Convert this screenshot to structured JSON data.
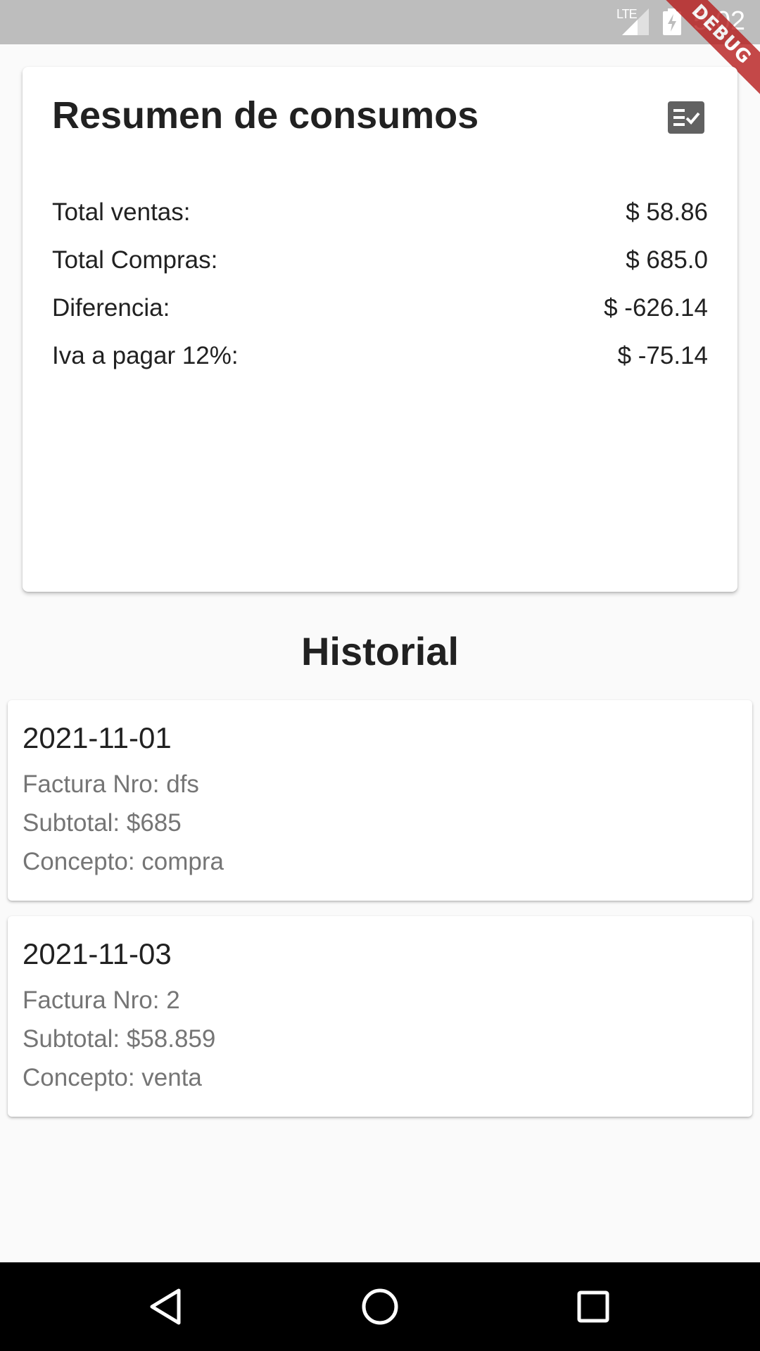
{
  "status_bar": {
    "network": "LTE",
    "time": "5:02",
    "debug_label": "DEBUG"
  },
  "summary": {
    "title": "Resumen de consumos",
    "icon": "checklist-icon",
    "rows": [
      {
        "label": "Total ventas:",
        "value": "$ 58.86"
      },
      {
        "label": "Total Compras:",
        "value": "$ 685.0"
      },
      {
        "label": "Diferencia:",
        "value": "$ -626.14"
      },
      {
        "label": "Iva a pagar 12%:",
        "value": "$ -75.14"
      }
    ]
  },
  "historial": {
    "title": "Historial",
    "items": [
      {
        "date": "2021-11-01",
        "factura": "Factura Nro: dfs",
        "subtotal": "Subtotal: $685",
        "concepto": "Concepto: compra"
      },
      {
        "date": "2021-11-03",
        "factura": "Factura Nro: 2",
        "subtotal": "Subtotal: $58.859",
        "concepto": "Concepto: venta"
      }
    ]
  },
  "nav_bar": {
    "buttons": [
      "back-icon",
      "home-icon",
      "recents-icon"
    ]
  },
  "colors": {
    "status_bar": "#bdbdbd",
    "background": "#fafafa",
    "card": "#ffffff",
    "primary_text": "#212121",
    "secondary_text": "#757575",
    "debug_banner": "#b71c1c",
    "nav_bar": "#000000"
  }
}
